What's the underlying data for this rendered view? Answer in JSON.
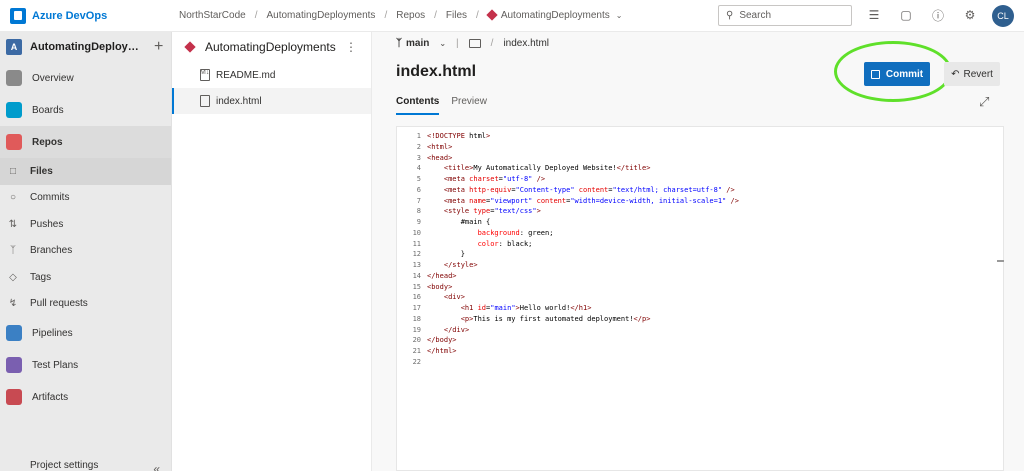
{
  "app": {
    "name": "Azure DevOps"
  },
  "breadcrumb": [
    {
      "label": "NorthStarCode"
    },
    {
      "label": "AutomatingDeployments"
    },
    {
      "label": "Repos"
    },
    {
      "label": "Files"
    },
    {
      "label": "AutomatingDeployments"
    }
  ],
  "search": {
    "placeholder": "Search"
  },
  "user": {
    "initials": "CL"
  },
  "sidebar": {
    "project_badge": "A",
    "project_name": "AutomatingDeployme...",
    "items": [
      {
        "label": "Overview",
        "color": "#8a8a8a"
      },
      {
        "label": "Boards",
        "color": "#009ccc"
      },
      {
        "label": "Repos",
        "color": "#e05a5a"
      }
    ],
    "repo_subitems": [
      {
        "label": "Files",
        "icon": "file-icon"
      },
      {
        "label": "Commits",
        "icon": "commit-icon"
      },
      {
        "label": "Pushes",
        "icon": "push-icon"
      },
      {
        "label": "Branches",
        "icon": "branch-icon"
      },
      {
        "label": "Tags",
        "icon": "tag-icon"
      },
      {
        "label": "Pull requests",
        "icon": "pull-request-icon"
      }
    ],
    "more_items": [
      {
        "label": "Pipelines",
        "color": "#3b80c4"
      },
      {
        "label": "Test Plans",
        "color": "#7a5fb0"
      },
      {
        "label": "Artifacts",
        "color": "#c84a52"
      }
    ],
    "settings_label": "Project settings"
  },
  "filepane": {
    "repo_name": "AutomatingDeployments",
    "files": [
      {
        "name": "README.md",
        "icon": "markdown-icon"
      },
      {
        "name": "index.html",
        "icon": "html-file-icon"
      }
    ]
  },
  "main": {
    "branch": "main",
    "path": "index.html",
    "file_title": "index.html",
    "commit_label": "Commit",
    "revert_label": "Revert",
    "tabs": [
      {
        "label": "Contents"
      },
      {
        "label": "Preview"
      }
    ]
  },
  "code": [
    {
      "n": "1",
      "t": "<!DOCTYPE html>"
    },
    {
      "n": "2",
      "t": "<html>"
    },
    {
      "n": "3",
      "t": "<head>"
    },
    {
      "n": "4",
      "t": "    <title>My Automatically Deployed Website!</title>"
    },
    {
      "n": "5",
      "t": "    <meta charset=\"utf-8\" />"
    },
    {
      "n": "6",
      "t": "    <meta http-equiv=\"Content-type\" content=\"text/html; charset=utf-8\" />"
    },
    {
      "n": "7",
      "t": "    <meta name=\"viewport\" content=\"width=device-width, initial-scale=1\" />"
    },
    {
      "n": "8",
      "t": "    <style type=\"text/css\">"
    },
    {
      "n": "9",
      "t": "        #main {"
    },
    {
      "n": "10",
      "t": "            background: green;"
    },
    {
      "n": "11",
      "t": "            color: black;"
    },
    {
      "n": "12",
      "t": "        }"
    },
    {
      "n": "13",
      "t": "    </style>"
    },
    {
      "n": "14",
      "t": "</head>"
    },
    {
      "n": "15",
      "t": "<body>"
    },
    {
      "n": "16",
      "t": "    <div>"
    },
    {
      "n": "17",
      "t": "        <h1 id=\"main\">Hello world!</h1>"
    },
    {
      "n": "18",
      "t": "        <p>This is my first automated deployment!</p>"
    },
    {
      "n": "19",
      "t": "    </div>"
    },
    {
      "n": "20",
      "t": "</body>"
    },
    {
      "n": "21",
      "t": "</html>"
    },
    {
      "n": "22",
      "t": ""
    }
  ]
}
